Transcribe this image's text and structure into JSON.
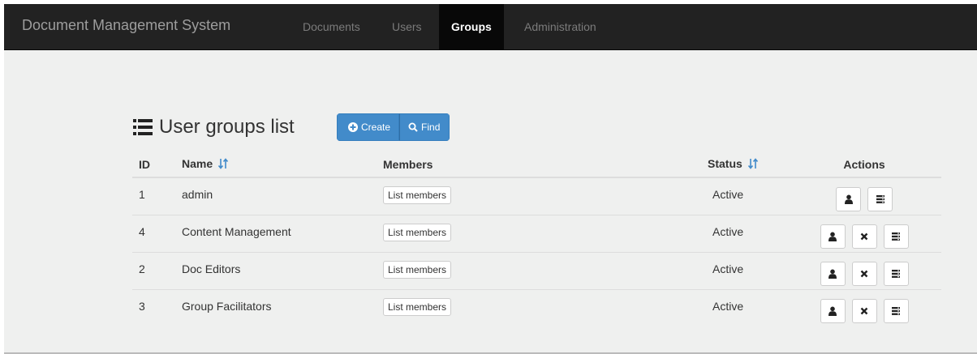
{
  "navbar": {
    "brand": "Document Management System",
    "items": [
      {
        "label": "Documents",
        "active": false
      },
      {
        "label": "Users",
        "active": false
      },
      {
        "label": "Groups",
        "active": true
      },
      {
        "label": "Administration",
        "active": false
      }
    ]
  },
  "page": {
    "title": "User groups list",
    "create_label": "Create",
    "find_label": "Find",
    "colors": {
      "primary": "#428bca",
      "navbar": "#222222",
      "active_tab": "#080808",
      "sort_icon": "#428bca"
    }
  },
  "table": {
    "headers": {
      "id": "ID",
      "name": "Name",
      "members": "Members",
      "status": "Status",
      "actions": "Actions"
    },
    "rows": [
      {
        "id": "1",
        "name": "admin",
        "members_label": "List members",
        "status": "Active",
        "actions": [
          "user-icon",
          "list-icon"
        ]
      },
      {
        "id": "4",
        "name": "Content Management",
        "members_label": "List members",
        "status": "Active",
        "actions": [
          "user-icon",
          "close-icon",
          "list-icon"
        ]
      },
      {
        "id": "2",
        "name": "Doc Editors",
        "members_label": "List members",
        "status": "Active",
        "actions": [
          "user-icon",
          "close-icon",
          "list-icon"
        ]
      },
      {
        "id": "3",
        "name": "Group Facilitators",
        "members_label": "List members",
        "status": "Active",
        "actions": [
          "user-icon",
          "close-icon",
          "list-icon"
        ]
      }
    ]
  }
}
